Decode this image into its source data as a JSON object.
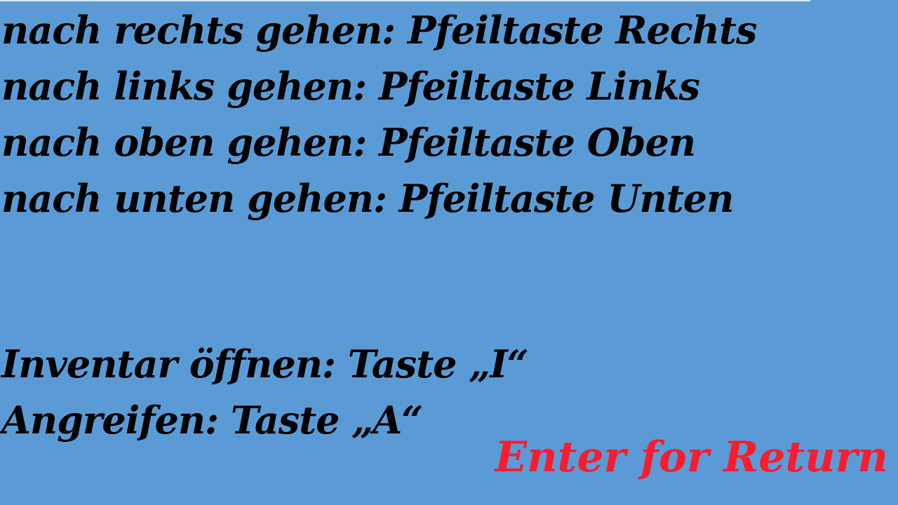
{
  "controls": {
    "move_right": "nach rechts gehen: Pfeiltaste Rechts",
    "move_left": "nach links gehen: Pfeiltaste Links",
    "move_up": "nach oben gehen: Pfeiltaste Oben",
    "move_down": "nach unten gehen: Pfeiltaste Unten",
    "open_inventory": "Inventar öffnen: Taste „I“",
    "attack": "Angreifen: Taste „A“"
  },
  "return_label": "Enter for Return",
  "colors": {
    "background": "#5b9bd5",
    "text": "#000000",
    "return_text": "#ff1a2e"
  }
}
